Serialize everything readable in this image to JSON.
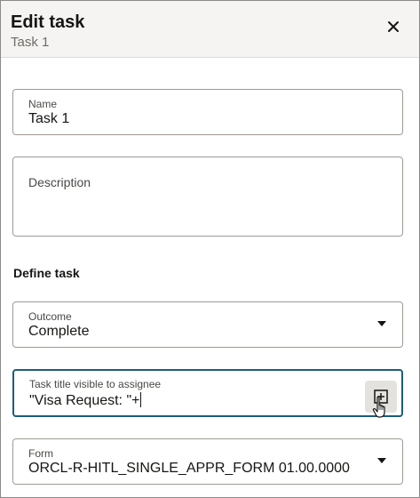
{
  "header": {
    "title": "Edit task",
    "subtitle": "Task 1",
    "close_icon": "close-icon"
  },
  "name_field": {
    "label": "Name",
    "value": "Task 1"
  },
  "description_field": {
    "label": "Description",
    "value": ""
  },
  "section": {
    "title": "Define task"
  },
  "outcome_field": {
    "label": "Outcome",
    "value": "Complete",
    "icon": "chevron-down-icon"
  },
  "task_title_field": {
    "label": "Task title visible to assignee",
    "value": "\"Visa Request: \"+",
    "button_icon": "insert-expression-icon"
  },
  "form_field": {
    "label": "Form",
    "value": "ORCL-R-HITL_SINGLE_APPR_FORM 01.00.0000",
    "icon": "chevron-down-icon"
  },
  "colors": {
    "accent": "#1d5b7e",
    "header_bg": "#f5f4f2",
    "border": "#9e9b96"
  }
}
